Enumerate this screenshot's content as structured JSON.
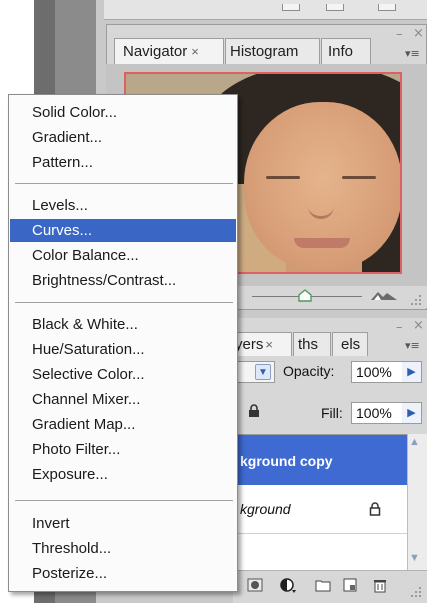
{
  "navigator_panel": {
    "tabs": [
      {
        "label": "Navigator",
        "close": "×",
        "active": true
      },
      {
        "label": "Histogram",
        "close": "",
        "active": false
      },
      {
        "label": "Info",
        "close": "",
        "active": false
      }
    ],
    "controls": {
      "minimize": "–",
      "close": "×",
      "menu": "▾≡"
    }
  },
  "layers_panel": {
    "tabs": [
      {
        "label": "yers",
        "close": "×",
        "active": true
      },
      {
        "label": "ths",
        "close": "",
        "active": false
      },
      {
        "label": "els",
        "close": "",
        "active": false
      }
    ],
    "controls": {
      "minimize": "–",
      "close": "×",
      "menu": "▾≡"
    },
    "opacity_label": "Opacity:",
    "opacity_value": "100%",
    "fill_label": "Fill:",
    "fill_value": "100%",
    "layers": [
      {
        "name": "kground copy",
        "selected": true
      },
      {
        "name": "kground",
        "selected": false
      }
    ]
  },
  "adjustment_menu": {
    "groups": [
      [
        "Solid Color...",
        "Gradient...",
        "Pattern..."
      ],
      [
        "Levels...",
        "Curves...",
        "Color Balance...",
        "Brightness/Contrast..."
      ],
      [
        "Black & White...",
        "Hue/Saturation...",
        "Selective Color...",
        "Channel Mixer...",
        "Gradient Map...",
        "Photo Filter...",
        "Exposure..."
      ],
      [
        "Invert",
        "Threshold...",
        "Posterize..."
      ]
    ],
    "highlighted": "Curves..."
  },
  "colors": {
    "menu_highlight": "#3a67c6",
    "layer_selected": "#3e6ad2",
    "navigator_view_box": "#e06060",
    "left_strip": "#6d6d6d"
  }
}
